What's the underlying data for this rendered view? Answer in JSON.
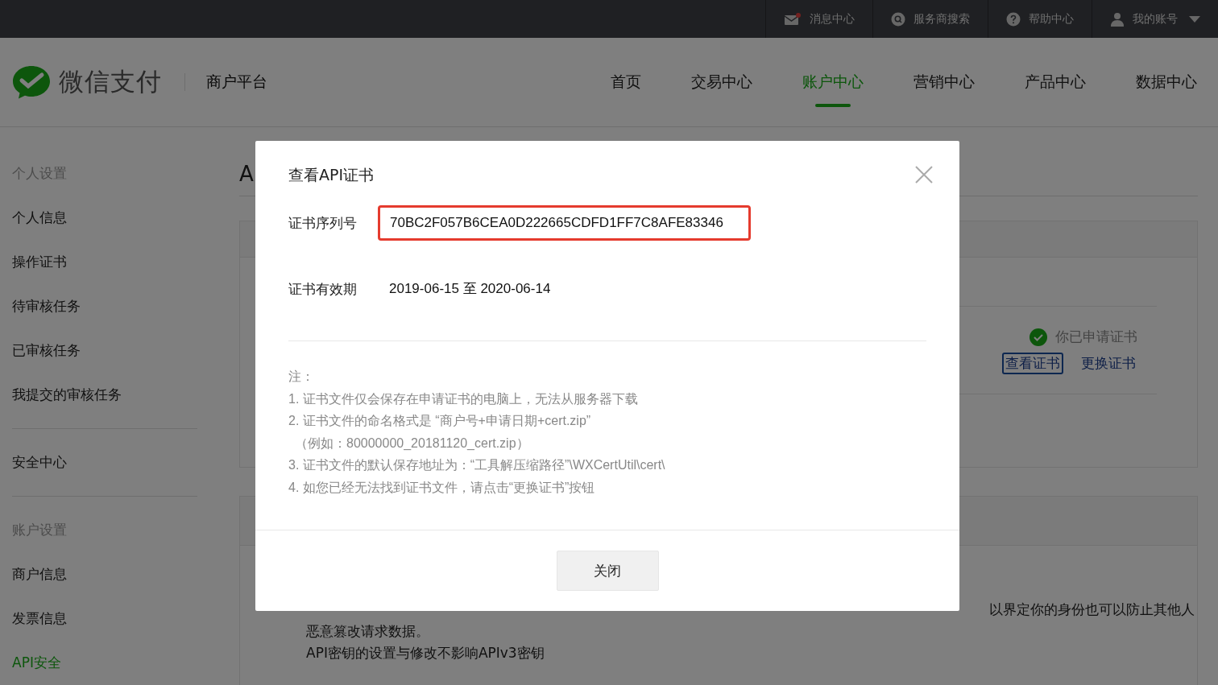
{
  "top_bar": {
    "items": [
      {
        "label": "消息中心",
        "kind": "mail"
      },
      {
        "label": "服务商搜索",
        "kind": "search"
      },
      {
        "label": "帮助中心",
        "kind": "help"
      },
      {
        "label": "我的账号",
        "kind": "account"
      }
    ]
  },
  "header": {
    "brand": "微信支付",
    "platform": "商户平台",
    "nav": [
      {
        "label": "首页",
        "selected": false
      },
      {
        "label": "交易中心",
        "selected": false
      },
      {
        "label": "账户中心",
        "selected": true
      },
      {
        "label": "营销中心",
        "selected": false
      },
      {
        "label": "产品中心",
        "selected": false
      },
      {
        "label": "数据中心",
        "selected": false
      }
    ]
  },
  "sidebar": {
    "groups": [
      {
        "title": "个人设置",
        "items": [
          {
            "label": "个人信息",
            "selected": false
          },
          {
            "label": "操作证书",
            "selected": false
          },
          {
            "label": "待审核任务",
            "selected": false
          },
          {
            "label": "已审核任务",
            "selected": false
          },
          {
            "label": "我提交的审核任务",
            "selected": false
          }
        ]
      },
      {
        "items": [
          {
            "label": "安全中心",
            "selected": false
          }
        ]
      },
      {
        "title": "账户设置",
        "items": [
          {
            "label": "商户信息",
            "selected": false
          },
          {
            "label": "发票信息",
            "selected": false
          },
          {
            "label": "API安全",
            "selected": true
          }
        ]
      }
    ]
  },
  "page": {
    "heading": "A",
    "cert_status": {
      "status": "你已申请证书",
      "view": "查看证书",
      "replace": "更换证书"
    },
    "notice": [
      "以界定你的身份也可以防止其他人",
      "恶意篡改请求数据。",
      "API密钥的设置与修改不影响APIv3密钥"
    ]
  },
  "dialog": {
    "title": "查看API证书",
    "fields": [
      {
        "label": "证书序列号",
        "value": "70BC2F057B6CEA0D222665CDFD1FF7C8AFE83346",
        "highlighted": true
      },
      {
        "label": "证书有效期",
        "value": "2019-06-15 至 2020-06-14",
        "highlighted": false
      }
    ],
    "notes": [
      "注：",
      "1. 证书文件仅会保存在申请证书的电脑上，无法从服务器下载",
      "2. 证书文件的命名格式是 “商户号+申请日期+cert.zip”",
      "（例如：80000000_20181120_cert.zip）",
      "3. 证书文件的默认保存地址为：“工具解压缩路径”\\WXCertUtil\\cert\\",
      "4. 如您已经无法找到证书文件，请点击“更换证书”按钮"
    ],
    "button": "关闭"
  }
}
